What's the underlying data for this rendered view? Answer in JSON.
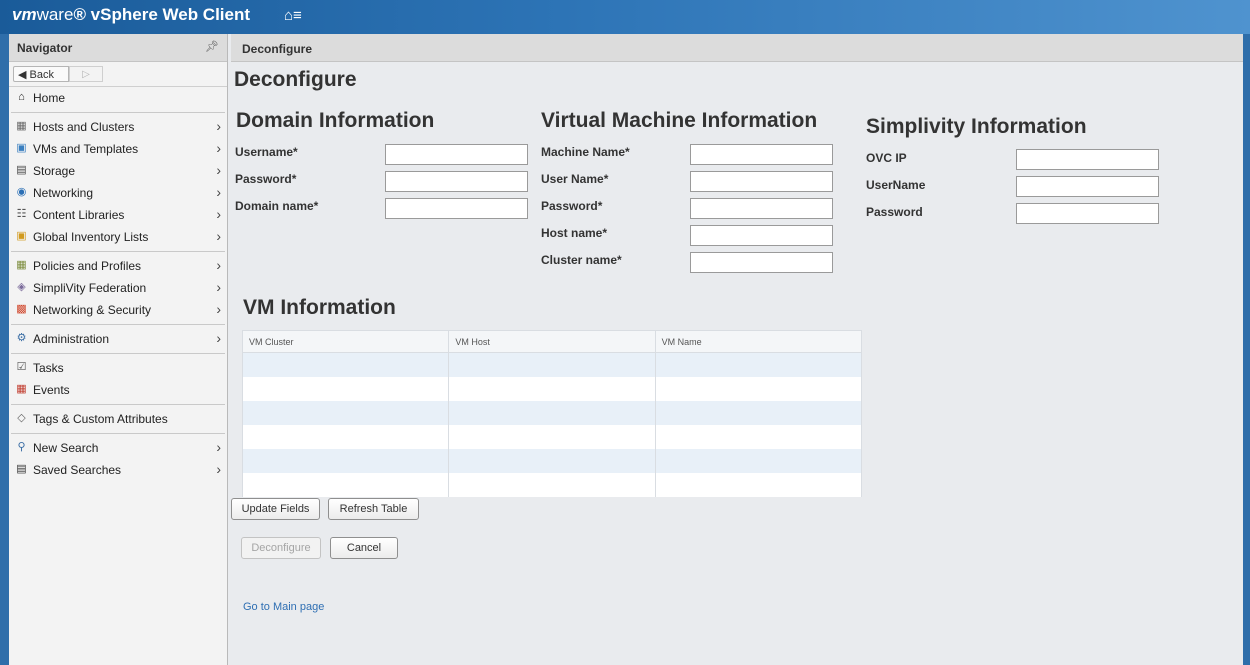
{
  "header": {
    "brand_vm": "vm",
    "brand_ware": "ware",
    "brand_rest": "® vSphere Web Client",
    "home_glyph": "⌂≡"
  },
  "navigator": {
    "title": "Navigator",
    "back_label": "◀ Back",
    "forward_label": "▷",
    "items": [
      {
        "label": "Home",
        "icon": "home-icon"
      },
      {
        "label": "Hosts and Clusters",
        "icon": "hosts-icon"
      },
      {
        "label": "VMs and Templates",
        "icon": "vm-icon"
      },
      {
        "label": "Storage",
        "icon": "storage-icon"
      },
      {
        "label": "Networking",
        "icon": "network-icon"
      },
      {
        "label": "Content Libraries",
        "icon": "library-icon"
      },
      {
        "label": "Global Inventory Lists",
        "icon": "inventory-icon"
      },
      {
        "label": "Policies and Profiles",
        "icon": "policies-icon"
      },
      {
        "label": "SimpliVity Federation",
        "icon": "federation-icon"
      },
      {
        "label": "Networking & Security",
        "icon": "security-icon"
      },
      {
        "label": "Administration",
        "icon": "admin-icon"
      },
      {
        "label": "Tasks",
        "icon": "tasks-icon"
      },
      {
        "label": "Events",
        "icon": "events-icon"
      },
      {
        "label": "Tags & Custom Attributes",
        "icon": "tag-icon"
      },
      {
        "label": "New Search",
        "icon": "search-icon"
      },
      {
        "label": "Saved Searches",
        "icon": "save-icon"
      }
    ]
  },
  "breadcrumb": "Deconfigure",
  "page_title": "Deconfigure",
  "domain": {
    "heading": "Domain Information",
    "username_label": "Username*",
    "password_label": "Password*",
    "domain_label": "Domain name*"
  },
  "vm_info_form": {
    "heading": "Virtual Machine Information",
    "machine_label": "Machine Name*",
    "user_label": "User Name*",
    "password_label": "Password*",
    "host_label": "Host name*",
    "cluster_label": "Cluster name*"
  },
  "simplivity": {
    "heading": "Simplivity Information",
    "ovc_label": "OVC IP",
    "username_label": "UserName",
    "password_label": "Password"
  },
  "vm_table": {
    "heading": "VM Information",
    "columns": [
      "VM Cluster",
      "VM Host",
      "VM Name"
    ]
  },
  "buttons": {
    "update": "Update Fields",
    "refresh": "Refresh Table",
    "deconfigure": "Deconfigure",
    "cancel": "Cancel"
  },
  "main_link": "Go to Main page",
  "colors": {
    "header_blue": "#1a5b99",
    "link": "#2f6fb3",
    "row_alt": "#e8f0f8"
  }
}
